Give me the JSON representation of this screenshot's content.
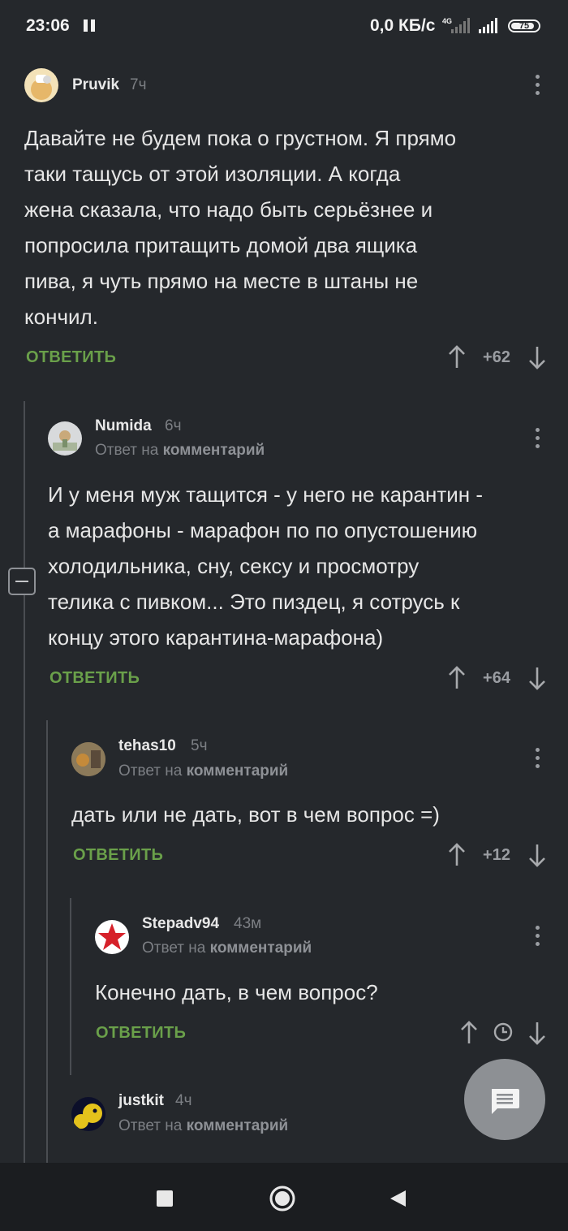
{
  "status_bar": {
    "time": "23:06",
    "speed": "0,0 КБ/с",
    "network": "4G",
    "battery": "75"
  },
  "comments": [
    {
      "username": "Pruvik",
      "time": "7ч",
      "reply_to": null,
      "text_lines": [
        "Давайте не будем пока о грустном. Я прямо",
        "таки тащусь от этой изоляции. А когда",
        "жена сказала, что надо быть серьёзнее и",
        "попросила притащить домой два ящика",
        "пива, я чуть прямо на месте в штаны не",
        "кончил."
      ],
      "answer_label": "ОТВЕТИТЬ",
      "rating": "+62"
    },
    {
      "username": "Numida",
      "time": "6ч",
      "reply_prefix": "Ответ на",
      "reply_target": "комментарий",
      "text_lines": [
        "И у меня муж тащится - у него не карантин -",
        "а марафоны - марафон по по опустошению",
        "холодильника, сну, сексу и просмотру",
        "телика с пивком... Это пиздец, я сотрусь к",
        "концу этого карантина-марафона)"
      ],
      "answer_label": "ОТВЕТИТЬ",
      "rating": "+64"
    },
    {
      "username": "tehas10",
      "time": "5ч",
      "reply_prefix": "Ответ на",
      "reply_target": "комментарий",
      "text_lines": [
        "дать или не дать, вот в чем вопрос =)"
      ],
      "answer_label": "ОТВЕТИТЬ",
      "rating": "+12"
    },
    {
      "username": "Stepadv94",
      "time": "43м",
      "reply_prefix": "Ответ на",
      "reply_target": "комментарий",
      "text_lines": [
        "Конечно дать, в чем вопрос?"
      ],
      "answer_label": "ОТВЕТИТЬ",
      "rating_icon": "clock-icon"
    },
    {
      "username": "justkit",
      "time": "4ч",
      "reply_prefix": "Ответ на",
      "reply_target": "комментарий"
    }
  ],
  "colors": {
    "background": "#25282c",
    "answer": "#6aa04a",
    "muted": "#7c7f84",
    "fab": "#8d9094"
  }
}
